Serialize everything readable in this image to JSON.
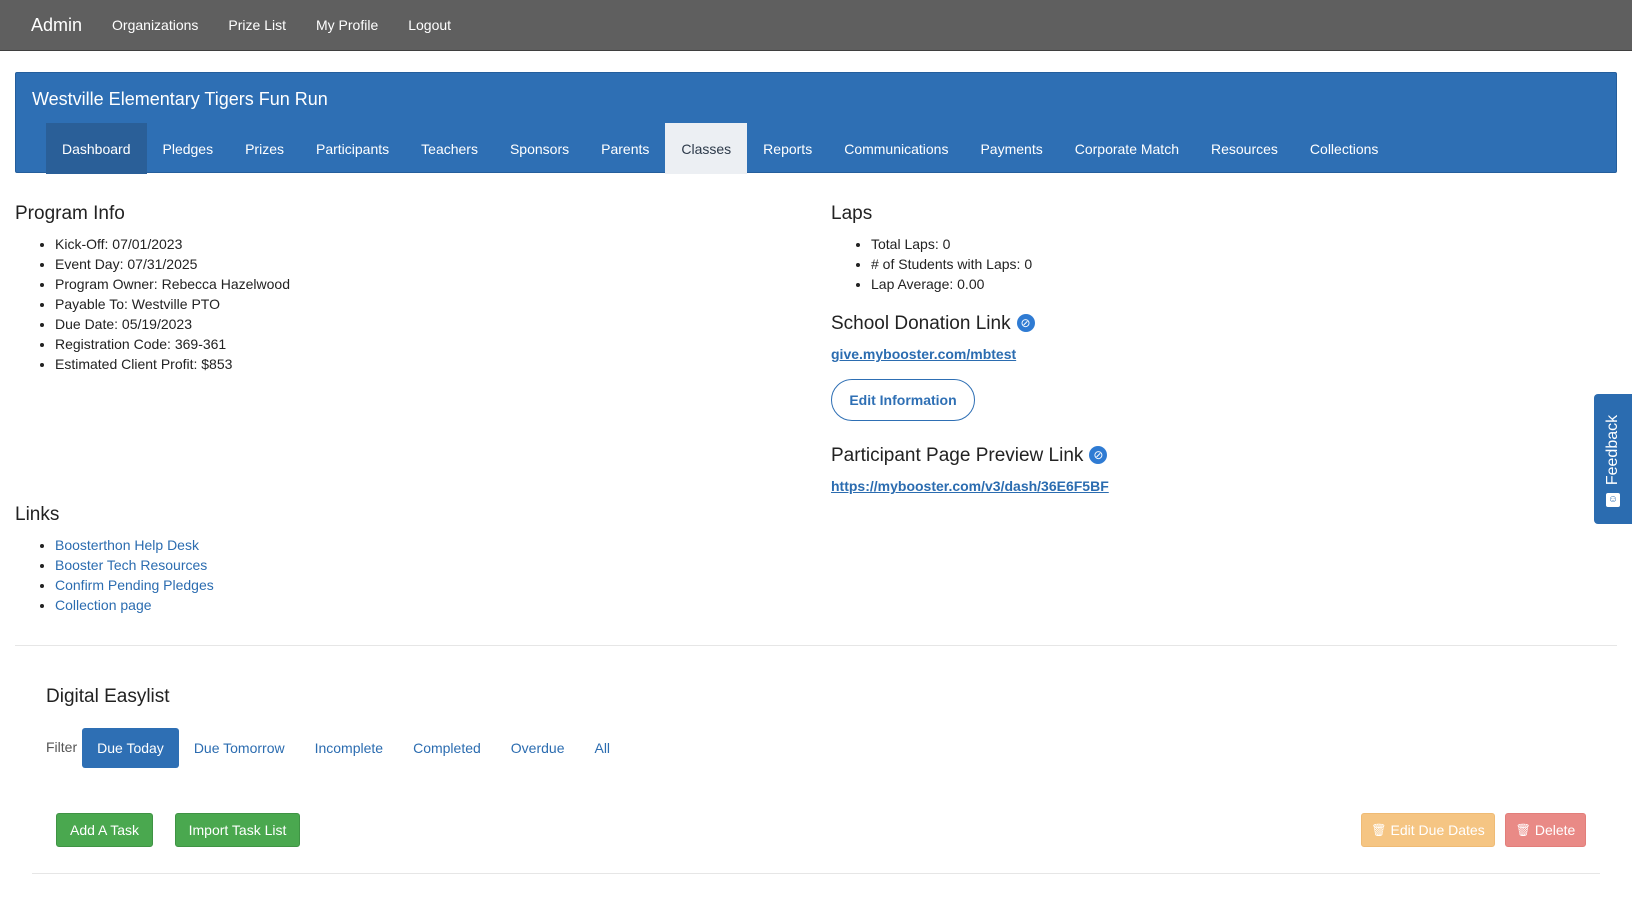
{
  "navbar": {
    "brand": "Admin",
    "links": [
      "Organizations",
      "Prize List",
      "My Profile",
      "Logout"
    ]
  },
  "program": {
    "title": "Westville Elementary Tigers Fun Run",
    "tabs": [
      "Dashboard",
      "Pledges",
      "Prizes",
      "Participants",
      "Teachers",
      "Sponsors",
      "Parents",
      "Classes",
      "Reports",
      "Communications",
      "Payments",
      "Corporate Match",
      "Resources",
      "Collections"
    ],
    "active_tab": "Classes"
  },
  "program_info": {
    "title": "Program Info",
    "items": [
      "Kick-Off: 07/01/2023",
      "Event Day: 07/31/2025",
      "Program Owner: Rebecca Hazelwood",
      "Payable To: Westville PTO",
      "Due Date: 05/19/2023",
      "Registration Code: 369-361",
      "Estimated Client Profit: $853"
    ]
  },
  "laps": {
    "title": "Laps",
    "items": [
      "Total Laps: 0",
      "# of Students with Laps: 0",
      "Lap Average: 0.00"
    ]
  },
  "donation": {
    "title": "School Donation Link",
    "link": "give.mybooster.com/mbtest",
    "edit_button": "Edit Information"
  },
  "preview": {
    "title": "Participant Page Preview Link",
    "link": "https://mybooster.com/v3/dash/36E6F5BF"
  },
  "links": {
    "title": "Links",
    "items": [
      "Boosterthon Help Desk",
      "Booster Tech Resources",
      "Confirm Pending Pledges",
      "Collection page"
    ]
  },
  "easylist": {
    "title": "Digital Easylist",
    "filter_label": "Filter",
    "filters": [
      "Due Today",
      "Due Tomorrow",
      "Incomplete",
      "Completed",
      "Overdue",
      "All"
    ],
    "active_filter": "Due Today",
    "add_task": "Add A Task",
    "import_task": "Import Task List",
    "edit_due_dates": "Edit Due Dates",
    "delete": "Delete"
  },
  "feedback": {
    "label": "Feedback"
  },
  "colors": {
    "navbar_bg": "#5f5f5f",
    "primary": "#2e6fb4",
    "success": "#4aa84f",
    "warning": "#f5c583",
    "danger": "#e98a86"
  }
}
